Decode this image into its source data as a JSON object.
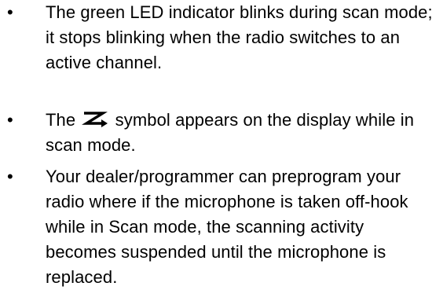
{
  "bullets": [
    {
      "marker": "•",
      "text": "The green LED indicator blinks during scan mode; it stops blinking when the radio switches to an active channel."
    },
    {
      "marker": "•",
      "text_before": "The ",
      "icon": "scan-z-arrow-icon",
      "text_after": " symbol appears on the display while in scan mode."
    },
    {
      "marker": "•",
      "text": "Your dealer/programmer can preprogram your radio where if the microphone is taken off-hook while in Scan mode, the scanning activity becomes suspended until the microphone is replaced."
    }
  ]
}
